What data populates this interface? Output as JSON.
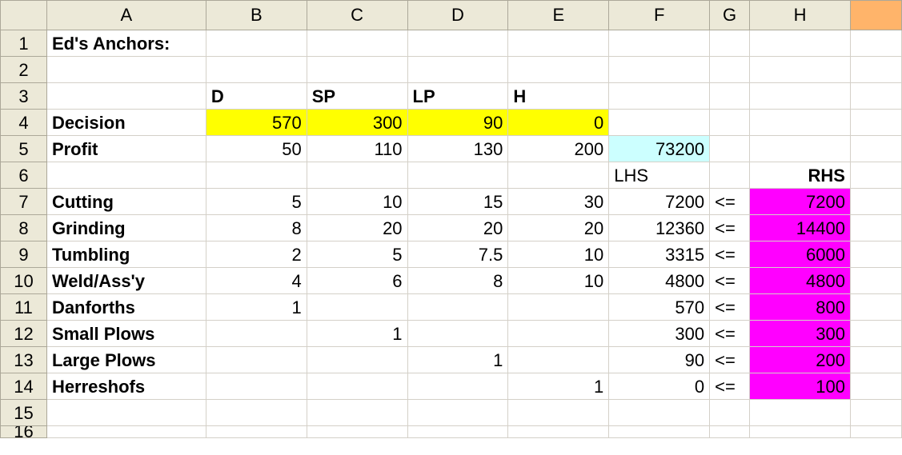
{
  "columns": [
    "A",
    "B",
    "C",
    "D",
    "E",
    "F",
    "G",
    "H",
    ""
  ],
  "rows": [
    {
      "num": "1",
      "cells": [
        "Ed's Anchors:",
        "",
        "",
        "",
        "",
        "",
        "",
        "",
        ""
      ]
    },
    {
      "num": "2",
      "cells": [
        "",
        "",
        "",
        "",
        "",
        "",
        "",
        "",
        ""
      ]
    },
    {
      "num": "3",
      "cells": [
        "",
        "D",
        "SP",
        "LP",
        "H",
        "",
        "",
        "",
        ""
      ]
    },
    {
      "num": "4",
      "cells": [
        "Decision",
        "570",
        "300",
        "90",
        "0",
        "",
        "",
        "",
        ""
      ]
    },
    {
      "num": "5",
      "cells": [
        "Profit",
        "50",
        "110",
        "130",
        "200",
        "73200",
        "",
        "",
        ""
      ]
    },
    {
      "num": "6",
      "cells": [
        "",
        "",
        "",
        "",
        "",
        "LHS",
        "",
        "RHS",
        ""
      ]
    },
    {
      "num": "7",
      "cells": [
        "Cutting",
        "5",
        "10",
        "15",
        "30",
        "7200",
        "<=",
        "7200",
        ""
      ]
    },
    {
      "num": "8",
      "cells": [
        "Grinding",
        "8",
        "20",
        "20",
        "20",
        "12360",
        "<=",
        "14400",
        ""
      ]
    },
    {
      "num": "9",
      "cells": [
        "Tumbling",
        "2",
        "5",
        "7.5",
        "10",
        "3315",
        "<=",
        "6000",
        ""
      ]
    },
    {
      "num": "10",
      "cells": [
        "Weld/Ass'y",
        "4",
        "6",
        "8",
        "10",
        "4800",
        "<=",
        "4800",
        ""
      ]
    },
    {
      "num": "11",
      "cells": [
        "Danforths",
        "1",
        "",
        "",
        "",
        "570",
        "<=",
        "800",
        ""
      ]
    },
    {
      "num": "12",
      "cells": [
        "Small Plows",
        "",
        "1",
        "",
        "",
        "300",
        "<=",
        "300",
        ""
      ]
    },
    {
      "num": "13",
      "cells": [
        "Large Plows",
        "",
        "",
        "1",
        "",
        "90",
        "<=",
        "200",
        ""
      ]
    },
    {
      "num": "14",
      "cells": [
        "Herreshofs",
        "",
        "",
        "",
        "1",
        "0",
        "<=",
        "100",
        ""
      ]
    },
    {
      "num": "15",
      "cells": [
        "",
        "",
        "",
        "",
        "",
        "",
        "",
        "",
        ""
      ]
    },
    {
      "num": "16",
      "cells": [
        "",
        "",
        "",
        "",
        "",
        "",
        "",
        "",
        ""
      ]
    }
  ],
  "colors": {
    "decision_fill": "#ffff00",
    "objective_fill": "#ccffff",
    "rhs_fill": "#ff00ff",
    "selected_header": "#ffb46a",
    "header_bg": "#ece9d8",
    "gridline": "#d4d0c8"
  }
}
